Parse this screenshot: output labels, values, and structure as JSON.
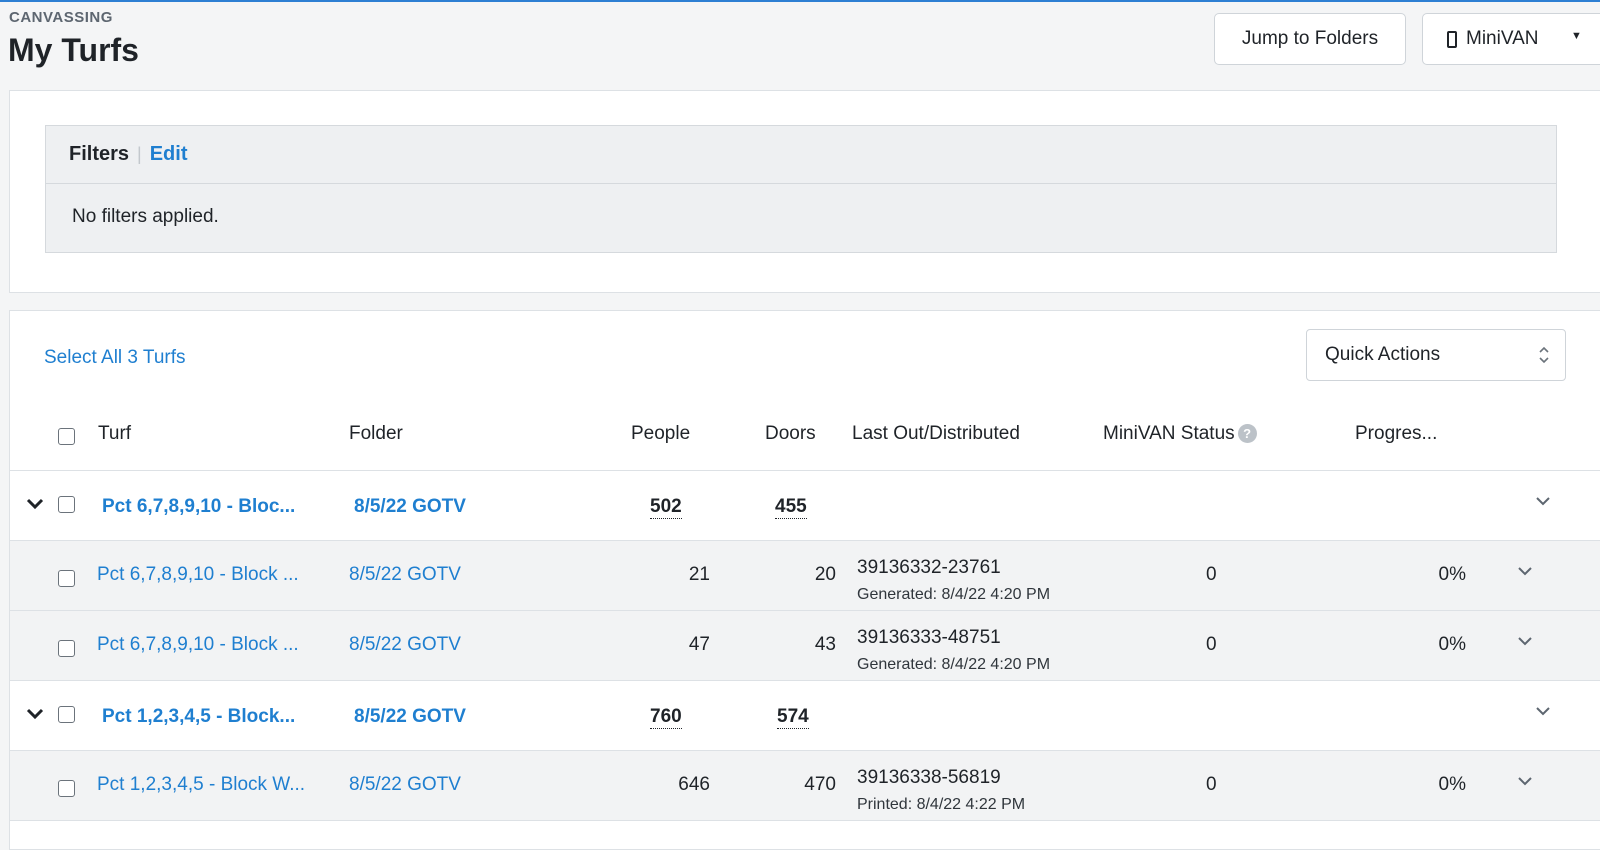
{
  "header": {
    "section": "CANVASSING",
    "title": "My Turfs",
    "jump_button": "Jump to Folders",
    "minivan_button": "MiniVAN"
  },
  "filters": {
    "title": "Filters",
    "edit_label": "Edit",
    "body": "No filters applied."
  },
  "turfs": {
    "select_all": "Select All 3 Turfs",
    "quick_actions": "Quick Actions",
    "columns": {
      "turf": "Turf",
      "folder": "Folder",
      "people": "People",
      "doors": "Doors",
      "last_out": "Last Out/Distributed",
      "minivan_status": "MiniVAN Status",
      "progress": "Progres..."
    },
    "rows": [
      {
        "kind": "parent",
        "turf": "Pct 6,7,8,9,10 - Bloc...",
        "folder": "8/5/22 GOTV",
        "people": "502",
        "doors": "455"
      },
      {
        "kind": "child",
        "turf": "Pct 6,7,8,9,10 - Block ...",
        "folder": "8/5/22 GOTV",
        "people": "21",
        "doors": "20",
        "list_id": "39136332-23761",
        "list_note": "Generated: 8/4/22 4:20 PM",
        "minivan": "0",
        "progress": "0%"
      },
      {
        "kind": "child",
        "turf": "Pct 6,7,8,9,10 - Block ...",
        "folder": "8/5/22 GOTV",
        "people": "47",
        "doors": "43",
        "list_id": "39136333-48751",
        "list_note": "Generated: 8/4/22 4:20 PM",
        "minivan": "0",
        "progress": "0%"
      },
      {
        "kind": "parent",
        "turf": "Pct 1,2,3,4,5 - Block...",
        "folder": "8/5/22 GOTV",
        "people": "760",
        "doors": "574"
      },
      {
        "kind": "child",
        "turf": "Pct 1,2,3,4,5 - Block W...",
        "folder": "8/5/22 GOTV",
        "people": "646",
        "doors": "470",
        "list_id": "39136338-56819",
        "list_note": "Printed: 8/4/22 4:22 PM",
        "minivan": "0",
        "progress": "0%"
      }
    ]
  }
}
